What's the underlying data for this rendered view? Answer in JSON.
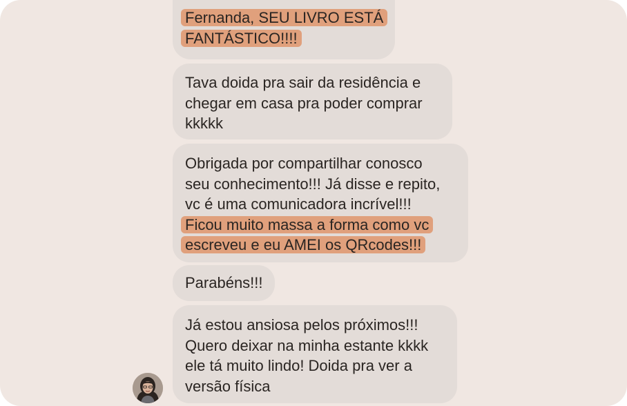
{
  "conversation": {
    "messages": [
      {
        "lines": [
          {
            "text": "Fernanda, SEU LIVRO ESTÁ",
            "highlight": true
          },
          {
            "text": "FANTÁSTICO!!!!",
            "highlight": true
          }
        ]
      },
      {
        "lines": [
          {
            "text": "Tava doida pra sair da residência e",
            "highlight": false
          },
          {
            "text": "chegar em casa pra poder comprar",
            "highlight": false
          },
          {
            "text": "kkkkk",
            "highlight": false
          }
        ]
      },
      {
        "lines": [
          {
            "text": "Obrigada por compartilhar conosco",
            "highlight": false
          },
          {
            "text": "seu conhecimento!!! Já disse e repito,",
            "highlight": false
          },
          {
            "text": "vc é uma comunicadora incrível!!!",
            "highlight": false
          },
          {
            "text": "Ficou muito massa a forma como vc",
            "highlight": true
          },
          {
            "text": "escreveu e eu AMEI os QRcodes!!!",
            "highlight": true
          }
        ]
      },
      {
        "lines": [
          {
            "text": "Parabéns!!!",
            "highlight": false
          }
        ]
      },
      {
        "lines": [
          {
            "text": "Já estou ansiosa pelos próximos!!!",
            "highlight": false
          },
          {
            "text": "Quero deixar na minha estante kkkk",
            "highlight": false
          },
          {
            "text": "ele tá muito lindo! Doida pra ver a",
            "highlight": false
          },
          {
            "text": "versão física",
            "highlight": false
          }
        ]
      }
    ],
    "colors": {
      "background": "#f0e7e2",
      "bubble": "#e3dcd8",
      "highlight": "#e0a07c",
      "text": "#2a2522"
    },
    "sender_avatar_icon": "user-avatar-photo"
  }
}
